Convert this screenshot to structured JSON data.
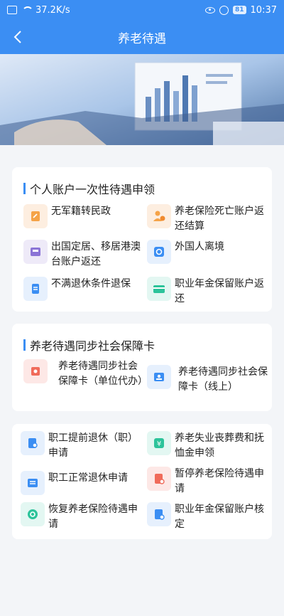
{
  "status": {
    "speed": "37.2K/s",
    "battery": "81",
    "time": "10:37"
  },
  "header": {
    "title": "养老待遇"
  },
  "sections": [
    {
      "title": "个人账户一次性待遇申领",
      "items": [
        {
          "label": "无军籍转民政",
          "icon": "document-edit-icon"
        },
        {
          "label": "养老保险死亡账户返还结算",
          "icon": "person-money-icon"
        },
        {
          "label": "出国定居、移居港澳台账户返还",
          "icon": "tray-icon"
        },
        {
          "label": "外国人离境",
          "icon": "refresh-icon"
        },
        {
          "label": "不满退休条件退保",
          "icon": "database-icon"
        },
        {
          "label": "职业年金保留账户返还",
          "icon": "card-icon"
        }
      ]
    },
    {
      "title": "养老待遇同步社会保障卡",
      "items": [
        {
          "label": "养老待遇同步社会保障卡（单位代办）",
          "icon": "puzzle-icon"
        },
        {
          "label": "养老待遇同步社会保障卡（线上）",
          "icon": "id-card-icon"
        }
      ]
    },
    {
      "items": [
        {
          "label": "职工提前退休（职）申请",
          "icon": "document-search-icon"
        },
        {
          "label": "养老失业丧葬费和抚恤金申领",
          "icon": "yen-icon"
        },
        {
          "label": "职工正常退休申请",
          "icon": "list-icon"
        },
        {
          "label": "暂停养老保险待遇申请",
          "icon": "document-pause-icon"
        },
        {
          "label": "恢复养老保险待遇申请",
          "icon": "gear-refresh-icon"
        },
        {
          "label": "职业年金保留账户核定",
          "icon": "document-check-icon"
        }
      ]
    }
  ]
}
